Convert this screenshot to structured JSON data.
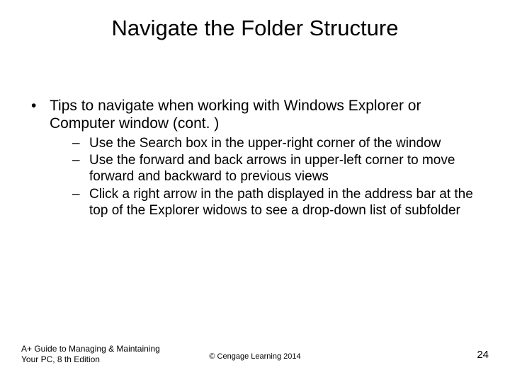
{
  "title": "Navigate the Folder Structure",
  "main": {
    "intro": "Tips to navigate when working with Windows Explorer or Computer window (cont. )",
    "subitems": [
      "Use the Search box in the upper-right corner of the window",
      "Use the forward and back arrows in upper-left corner to move forward and backward to previous views",
      "Click a right arrow in the path displayed in the address bar at the top of the Explorer widows to see a drop-down list of subfolder"
    ]
  },
  "footer": {
    "left_line1": "A+ Guide to Managing & Maintaining",
    "left_line2": "Your PC, 8 th Edition",
    "center": "© Cengage Learning  2014",
    "page": "24"
  }
}
